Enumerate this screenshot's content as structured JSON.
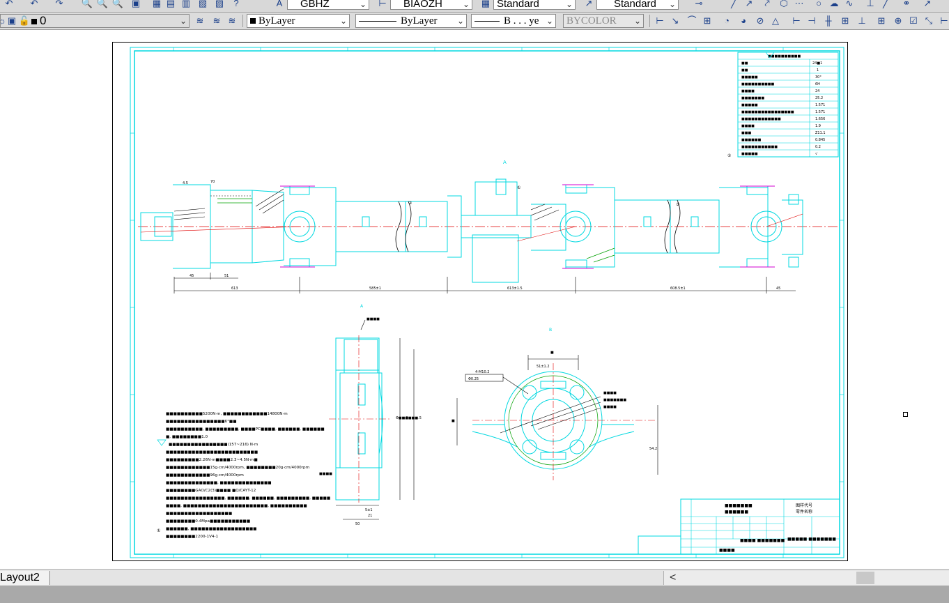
{
  "toolbar_top": {
    "text_style_1": "GBHZ",
    "dim_style": "BIAOZH",
    "table_style": "Standard",
    "mleader_style": "Standard"
  },
  "toolbar_props": {
    "layer_value": "0",
    "color_value": "ByLayer",
    "linetype_value": "ByLayer",
    "lineweight_value": "B . . . ye",
    "plotstyle_value": "BYCOLOR"
  },
  "drawing": {
    "section_a_label": "A",
    "section_b_label": "B",
    "item_markers": [
      "①",
      "②",
      "③"
    ],
    "title_block": {
      "part_code_label": "图样代号",
      "part_name_label": "零件名称"
    },
    "params_table_rows": 14
  },
  "layout_tabs": {
    "active": "Layout2"
  },
  "colors": {
    "cad_cyan": "#00d8e0",
    "cad_red": "#e00000",
    "cad_green": "#00a000",
    "cad_magenta": "#d000d0",
    "cad_blue": "#0000c0"
  }
}
